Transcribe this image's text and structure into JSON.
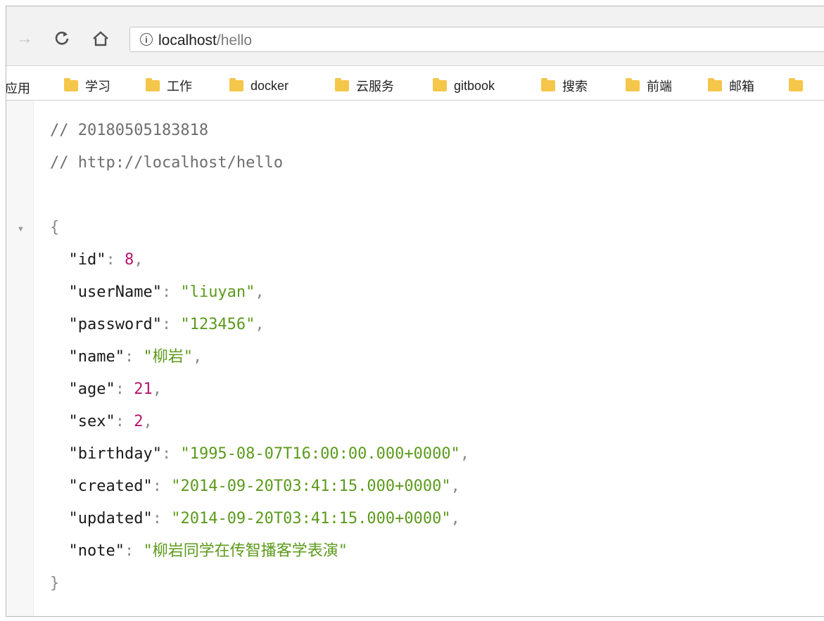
{
  "browser": {
    "address": {
      "host": "localhost",
      "path": "/hello"
    }
  },
  "bookmarks": {
    "apps_label": "应用",
    "items": [
      "学习",
      "工作",
      "docker",
      "云服务",
      "gitbook",
      "搜索",
      "前端",
      "邮箱"
    ]
  },
  "json_view": {
    "comment_timestamp": "// 20180505183818",
    "comment_url": "// http://localhost/hello",
    "open_brace": "{",
    "close_brace": "}",
    "fields": [
      {
        "key": "\"id\"",
        "value": "8",
        "type": "number"
      },
      {
        "key": "\"userName\"",
        "value": "\"liuyan\"",
        "type": "string"
      },
      {
        "key": "\"password\"",
        "value": "\"123456\"",
        "type": "string"
      },
      {
        "key": "\"name\"",
        "value": "\"柳岩\"",
        "type": "string"
      },
      {
        "key": "\"age\"",
        "value": "21",
        "type": "number"
      },
      {
        "key": "\"sex\"",
        "value": "2",
        "type": "number"
      },
      {
        "key": "\"birthday\"",
        "value": "\"1995-08-07T16:00:00.000+0000\"",
        "type": "string"
      },
      {
        "key": "\"created\"",
        "value": "\"2014-09-20T03:41:15.000+0000\"",
        "type": "string"
      },
      {
        "key": "\"updated\"",
        "value": "\"2014-09-20T03:41:15.000+0000\"",
        "type": "string"
      },
      {
        "key": "\"note\"",
        "value": "\"柳岩同学在传智播客学表演\"",
        "type": "string"
      }
    ]
  }
}
